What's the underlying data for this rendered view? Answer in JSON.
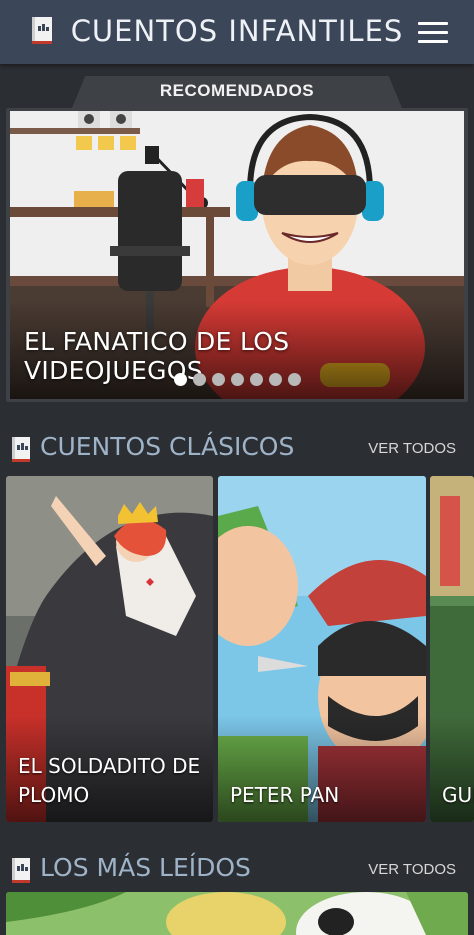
{
  "app": {
    "title": "CUENTOS INFANTILES"
  },
  "icons": {
    "app": "book-icon",
    "menu": "hamburger-menu-icon",
    "section": "book-icon"
  },
  "colors": {
    "topbar": "#3b4658",
    "background": "#2b2e33",
    "section_title": "#9fb3c8"
  },
  "recommended": {
    "label": "RECOMENDADOS",
    "featured_title": "EL FANATICO DE LOS VIDEOJUEGOS",
    "slide_count": 7,
    "active_slide": 1
  },
  "sections": [
    {
      "title": "CUENTOS CLÁSICOS",
      "see_all": "VER TODOS",
      "items": [
        {
          "line1": "EL SOLDADITO DE",
          "line2": "PLOMO"
        },
        {
          "line1": "PETER PAN",
          "line2": ""
        },
        {
          "line1": "GUL",
          "line2": ""
        }
      ]
    },
    {
      "title": "LOS MÁS LEÍDOS",
      "see_all": "VER TODOS"
    }
  ]
}
